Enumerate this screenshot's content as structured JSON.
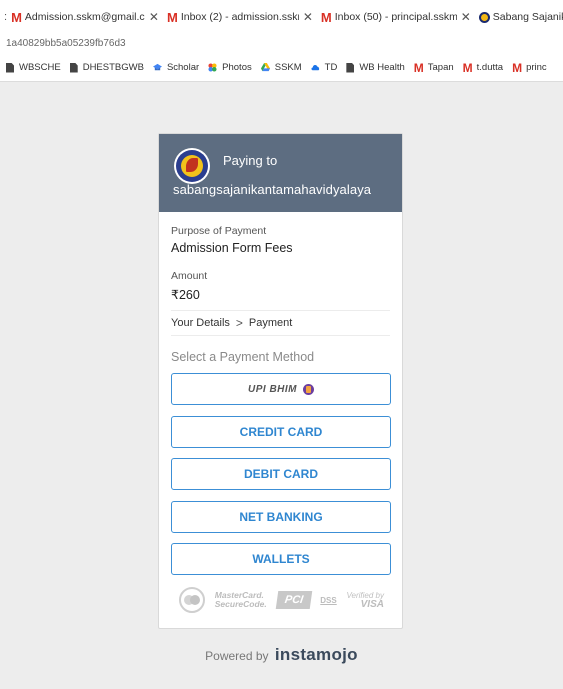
{
  "browser": {
    "tabs": [
      {
        "title": "Admission.sskm@gmail.co",
        "icon": "gmail-icon"
      },
      {
        "title": "Inbox (2) - admission.sskm",
        "icon": "gmail-icon"
      },
      {
        "title": "Inbox (50) - principal.sskm",
        "icon": "gmail-icon"
      },
      {
        "title": "Sabang Sajanikant",
        "icon": "college-icon"
      }
    ],
    "url_fragment": "1a40829bb5a05239fb76d3",
    "bookmarks": [
      {
        "label": "WBSCHE",
        "icon": "doc-icon"
      },
      {
        "label": "DHESTBGWB",
        "icon": "doc-icon"
      },
      {
        "label": "Scholar",
        "icon": "scholar-icon"
      },
      {
        "label": "Photos",
        "icon": "photos-icon"
      },
      {
        "label": "SSKM",
        "icon": "drive-icon"
      },
      {
        "label": "TD",
        "icon": "cloud-icon"
      },
      {
        "label": "WB Health",
        "icon": "doc-icon"
      },
      {
        "label": "Tapan",
        "icon": "gmail-icon"
      },
      {
        "label": "t.dutta",
        "icon": "gmail-icon"
      },
      {
        "label": "princ",
        "icon": "gmail-icon"
      }
    ]
  },
  "payment": {
    "paying_to_label": "Paying to",
    "merchant": "sabangsajanikantamahavidyalaya",
    "purpose_label": "Purpose of Payment",
    "purpose_value": "Admission Form Fees",
    "amount_label": "Amount",
    "amount_value": "₹260",
    "steps": {
      "step1": "Your Details",
      "separator": ">",
      "step2": "Payment"
    },
    "select_heading": "Select a Payment Method",
    "methods": {
      "upi": "UPI BHIM",
      "credit": "CREDIT CARD",
      "debit": "DEBIT CARD",
      "netbanking": "NET BANKING",
      "wallets": "WALLETS"
    },
    "trust": {
      "mastercard_line1": "MasterCard.",
      "mastercard_line2": "SecureCode.",
      "pci": "PCI",
      "dss": "DSS",
      "visa_line1": "Verified by",
      "visa_line2": "VISA"
    }
  },
  "footer": {
    "powered_by": "Powered by",
    "brand": "instamojo"
  },
  "colors": {
    "header_bg": "#5d6d81",
    "button_border": "#3c8fd6",
    "button_text": "#2f86d0",
    "page_bg": "#ededed"
  }
}
